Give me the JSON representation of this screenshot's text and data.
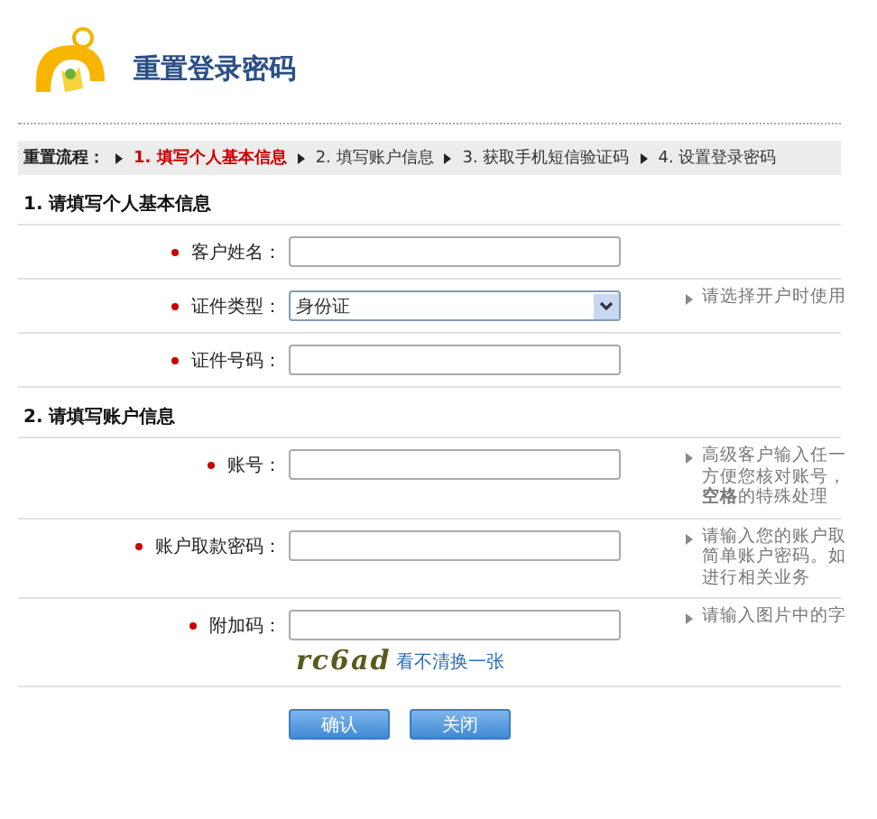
{
  "header": {
    "title": "重置登录密码"
  },
  "steps": {
    "label": "重置流程：",
    "items": [
      {
        "label": "1. 填写个人基本信息",
        "selected": true
      },
      {
        "label": "2. 填写账户信息",
        "selected": false
      },
      {
        "label": "3. 获取手机短信验证码",
        "selected": false
      },
      {
        "label": "4. 设置登录密码",
        "selected": false
      }
    ]
  },
  "sections": [
    {
      "title": "1. 请填写个人基本信息",
      "rows": [
        {
          "kind": "text",
          "label": "客户姓名：",
          "required": true
        },
        {
          "kind": "select",
          "label": "证件类型：",
          "required": true,
          "value": "身份证",
          "hint": [
            "请选择开户时使用"
          ]
        },
        {
          "kind": "text",
          "label": "证件号码：",
          "required": true
        }
      ]
    },
    {
      "title": "2. 请填写账户信息",
      "rows": [
        {
          "kind": "text",
          "label": "账号：",
          "required": true,
          "hint": [
            "高级客户输入任一",
            "方便您核对账号，",
            "**空格**的特殊处理"
          ]
        },
        {
          "kind": "text",
          "label": "账户取款密码：",
          "required": true,
          "hint": [
            "请输入您的账户取",
            "简单账户密码。如",
            "进行相关业务"
          ]
        },
        {
          "kind": "captcha",
          "label": "附加码：",
          "required": true,
          "hint": [
            "请输入图片中的字"
          ],
          "captcha": "rc6ad",
          "refresh": "看不清换一张"
        }
      ]
    }
  ],
  "buttons": [
    "确认",
    "关闭"
  ]
}
